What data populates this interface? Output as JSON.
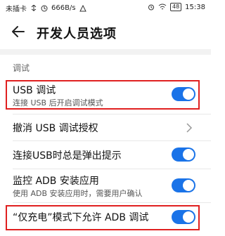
{
  "status_bar": {
    "carrier": "未插卡",
    "net_speed": "666B/s",
    "battery": "48",
    "time": "15:38"
  },
  "header": {
    "title": "开发人员选项"
  },
  "section": {
    "label": "调试"
  },
  "items": [
    {
      "title": "USB 调试",
      "subtitle": "连接 USB 后开启调试模式",
      "control": "toggle",
      "value": "on",
      "highlighted": true
    },
    {
      "title": "撤消 USB 调试授权",
      "control": "chevron"
    },
    {
      "title": "连接USB时总是弹出提示",
      "control": "toggle",
      "value": "on"
    },
    {
      "title": "监控 ADB 安装应用",
      "subtitle": "使用 ADB 安装应用时，需要用户确认",
      "control": "toggle",
      "value": "on"
    },
    {
      "title": "“仅充电”模式下允许 ADB 调试",
      "control": "toggle",
      "value": "on",
      "highlighted": true
    }
  ],
  "colors": {
    "accent": "#1a73e8",
    "highlight": "#e02020"
  }
}
